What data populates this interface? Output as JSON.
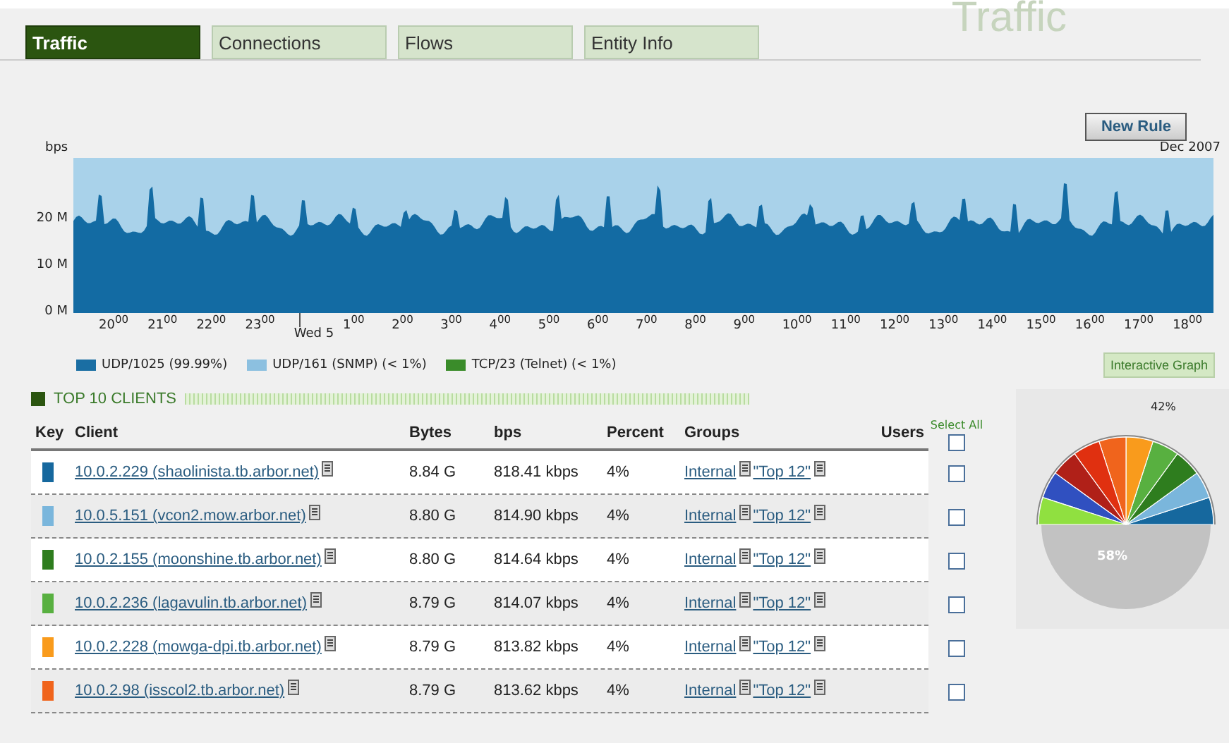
{
  "page_title": "Traffic",
  "tabs": [
    {
      "label": "Traffic",
      "selected": true
    },
    {
      "label": "Connections",
      "selected": false
    },
    {
      "label": "Flows",
      "selected": false
    },
    {
      "label": "Entity Info",
      "selected": false
    }
  ],
  "new_rule_button": "New Rule",
  "graph": {
    "y_label": "bps",
    "date_label": "Dec 2007",
    "y_ticks": [
      "20 M",
      "10 M",
      "0 M"
    ],
    "x_ticks": [
      {
        "kind": "hour",
        "label": "20$^{00}$"
      },
      {
        "kind": "hour",
        "label": "21$^{00}$"
      },
      {
        "kind": "hour",
        "label": "22$^{00}$"
      },
      {
        "kind": "hour",
        "label": "23$^{00}$"
      },
      {
        "kind": "day",
        "label": "Wed 5"
      },
      {
        "kind": "hour",
        "label": "1$^{00}$"
      },
      {
        "kind": "hour",
        "label": "2$^{00}$"
      },
      {
        "kind": "hour",
        "label": "3$^{00}$"
      },
      {
        "kind": "hour",
        "label": "4$^{00}$"
      },
      {
        "kind": "hour",
        "label": "5$^{00}$"
      },
      {
        "kind": "hour",
        "label": "6$^{00}$"
      },
      {
        "kind": "hour",
        "label": "7$^{00}$"
      },
      {
        "kind": "hour",
        "label": "8$^{00}$"
      },
      {
        "kind": "hour",
        "label": "9$^{00}$"
      },
      {
        "kind": "hour",
        "label": "10$^{00}$"
      },
      {
        "kind": "hour",
        "label": "11$^{00}$"
      },
      {
        "kind": "hour",
        "label": "12$^{00}$"
      },
      {
        "kind": "hour",
        "label": "13$^{00}$"
      },
      {
        "kind": "hour",
        "label": "14$^{00}$"
      },
      {
        "kind": "hour",
        "label": "15$^{00}$"
      },
      {
        "kind": "hour",
        "label": "16$^{00}$"
      },
      {
        "kind": "hour",
        "label": "17$^{00}$"
      },
      {
        "kind": "hour",
        "label": "18$^{00}$"
      }
    ],
    "legend": [
      {
        "label": "UDP/1025 (99.99%)",
        "color": "#1a6ea3"
      },
      {
        "label": "UDP/161 (SNMP) (< 1%)",
        "color": "#8cc0e0"
      },
      {
        "label": "TCP/23 (Telnet) (< 1%)",
        "color": "#3a8c2a"
      }
    ],
    "interactive_button": "Interactive Graph"
  },
  "clients": {
    "title": "TOP 10 CLIENTS",
    "select_all": "Select All",
    "select_all_checked": false,
    "columns": [
      "Key",
      "Client",
      "Bytes",
      "bps",
      "Percent",
      "Groups",
      "Users"
    ],
    "rows": [
      {
        "color": "#16689e",
        "client": "10.0.2.229 (shaolinista.tb.arbor.net)",
        "bytes": "8.84 G",
        "bps": "818.41 kbps",
        "percent": "4%",
        "groups": [
          "Internal",
          "\"Top 12\""
        ],
        "checked": false
      },
      {
        "color": "#7ab6dc",
        "client": "10.0.5.151 (vcon2.mow.arbor.net)",
        "bytes": "8.80 G",
        "bps": "814.90 kbps",
        "percent": "4%",
        "groups": [
          "Internal",
          "\"Top 12\""
        ],
        "checked": false
      },
      {
        "color": "#2e7d1e",
        "client": "10.0.2.155 (moonshine.tb.arbor.net)",
        "bytes": "8.80 G",
        "bps": "814.64 kbps",
        "percent": "4%",
        "groups": [
          "Internal",
          "\"Top 12\""
        ],
        "checked": false
      },
      {
        "color": "#58b040",
        "client": "10.0.2.236 (lagavulin.tb.arbor.net)",
        "bytes": "8.79 G",
        "bps": "814.07 kbps",
        "percent": "4%",
        "groups": [
          "Internal",
          "\"Top 12\""
        ],
        "checked": false
      },
      {
        "color": "#f99b1c",
        "client": "10.0.2.228 (mowga-dpi.tb.arbor.net)",
        "bytes": "8.79 G",
        "bps": "813.82 kbps",
        "percent": "4%",
        "groups": [
          "Internal",
          "\"Top 12\""
        ],
        "checked": false
      },
      {
        "color": "#f0641c",
        "client": "10.0.2.98 (isscol2.tb.arbor.net)",
        "bytes": "8.79 G",
        "bps": "813.62 kbps",
        "percent": "4%",
        "groups": [
          "Internal",
          "\"Top 12\""
        ],
        "checked": false
      }
    ]
  },
  "pie": {
    "top_label": "42%",
    "main_label": "58%"
  }
}
